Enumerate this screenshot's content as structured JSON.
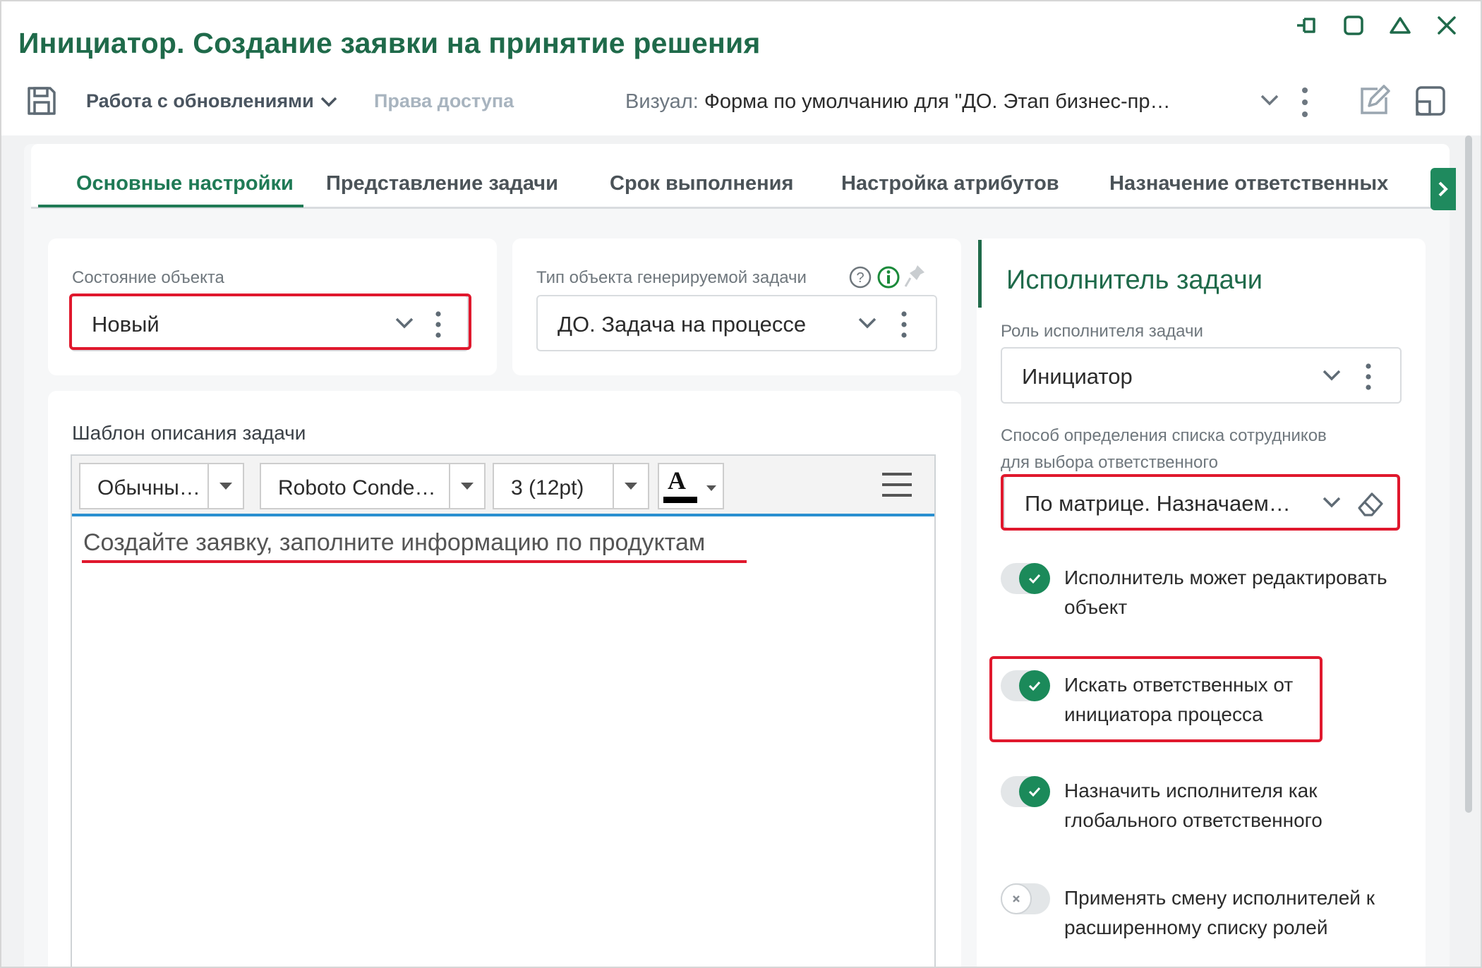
{
  "window": {
    "title": "Инициатор. Создание заявки на принятие решения"
  },
  "toolbar": {
    "updates_menu": "Работа с обновлениями",
    "access_rights": "Права доступа",
    "visual_label": "Визуал:",
    "visual_value": "Форма по умолчанию для \"ДО. Этап бизнес-пр…"
  },
  "tabs": [
    {
      "label": "Основные настройки"
    },
    {
      "label": "Представление задачи"
    },
    {
      "label": "Срок выполнения"
    },
    {
      "label": "Настройка атрибутов"
    },
    {
      "label": "Назначение ответственных"
    }
  ],
  "object_state": {
    "label": "Состояние объекта",
    "value": "Новый"
  },
  "task_type": {
    "label": "Тип объекта генерируемой задачи",
    "value": "ДО. Задача на процессе"
  },
  "template": {
    "label": "Шаблон описания задачи",
    "style": "Обычны…",
    "font": "Roboto Conde…",
    "size": "3 (12pt)",
    "font_color_glyph": "A",
    "content": "Создайте заявку, заполните информацию по продуктам"
  },
  "executor": {
    "section_title": "Исполнитель задачи",
    "role_label": "Роль исполнителя задачи",
    "role_value": "Инициатор",
    "method_label_line1": "Способ определения списка сотрудников",
    "method_label_line2": "для выбора ответственного",
    "method_value": "По матрице. Назначаем…",
    "toggles": [
      {
        "line1": "Исполнитель может редактировать",
        "line2": "объект",
        "on": true
      },
      {
        "line1": "Искать ответственных от",
        "line2": "инициатора процесса",
        "on": true
      },
      {
        "line1": "Назначить исполнителя как",
        "line2": "глобального ответственного",
        "on": true
      },
      {
        "line1": "Применять смену исполнителей к",
        "line2": "расширенному списку ролей",
        "on": false
      }
    ]
  },
  "colors": {
    "brand_green": "#1f6a4a",
    "accent_green": "#1f7a55",
    "highlight_red": "#e0182d",
    "editor_blue": "#2a8fd0"
  }
}
